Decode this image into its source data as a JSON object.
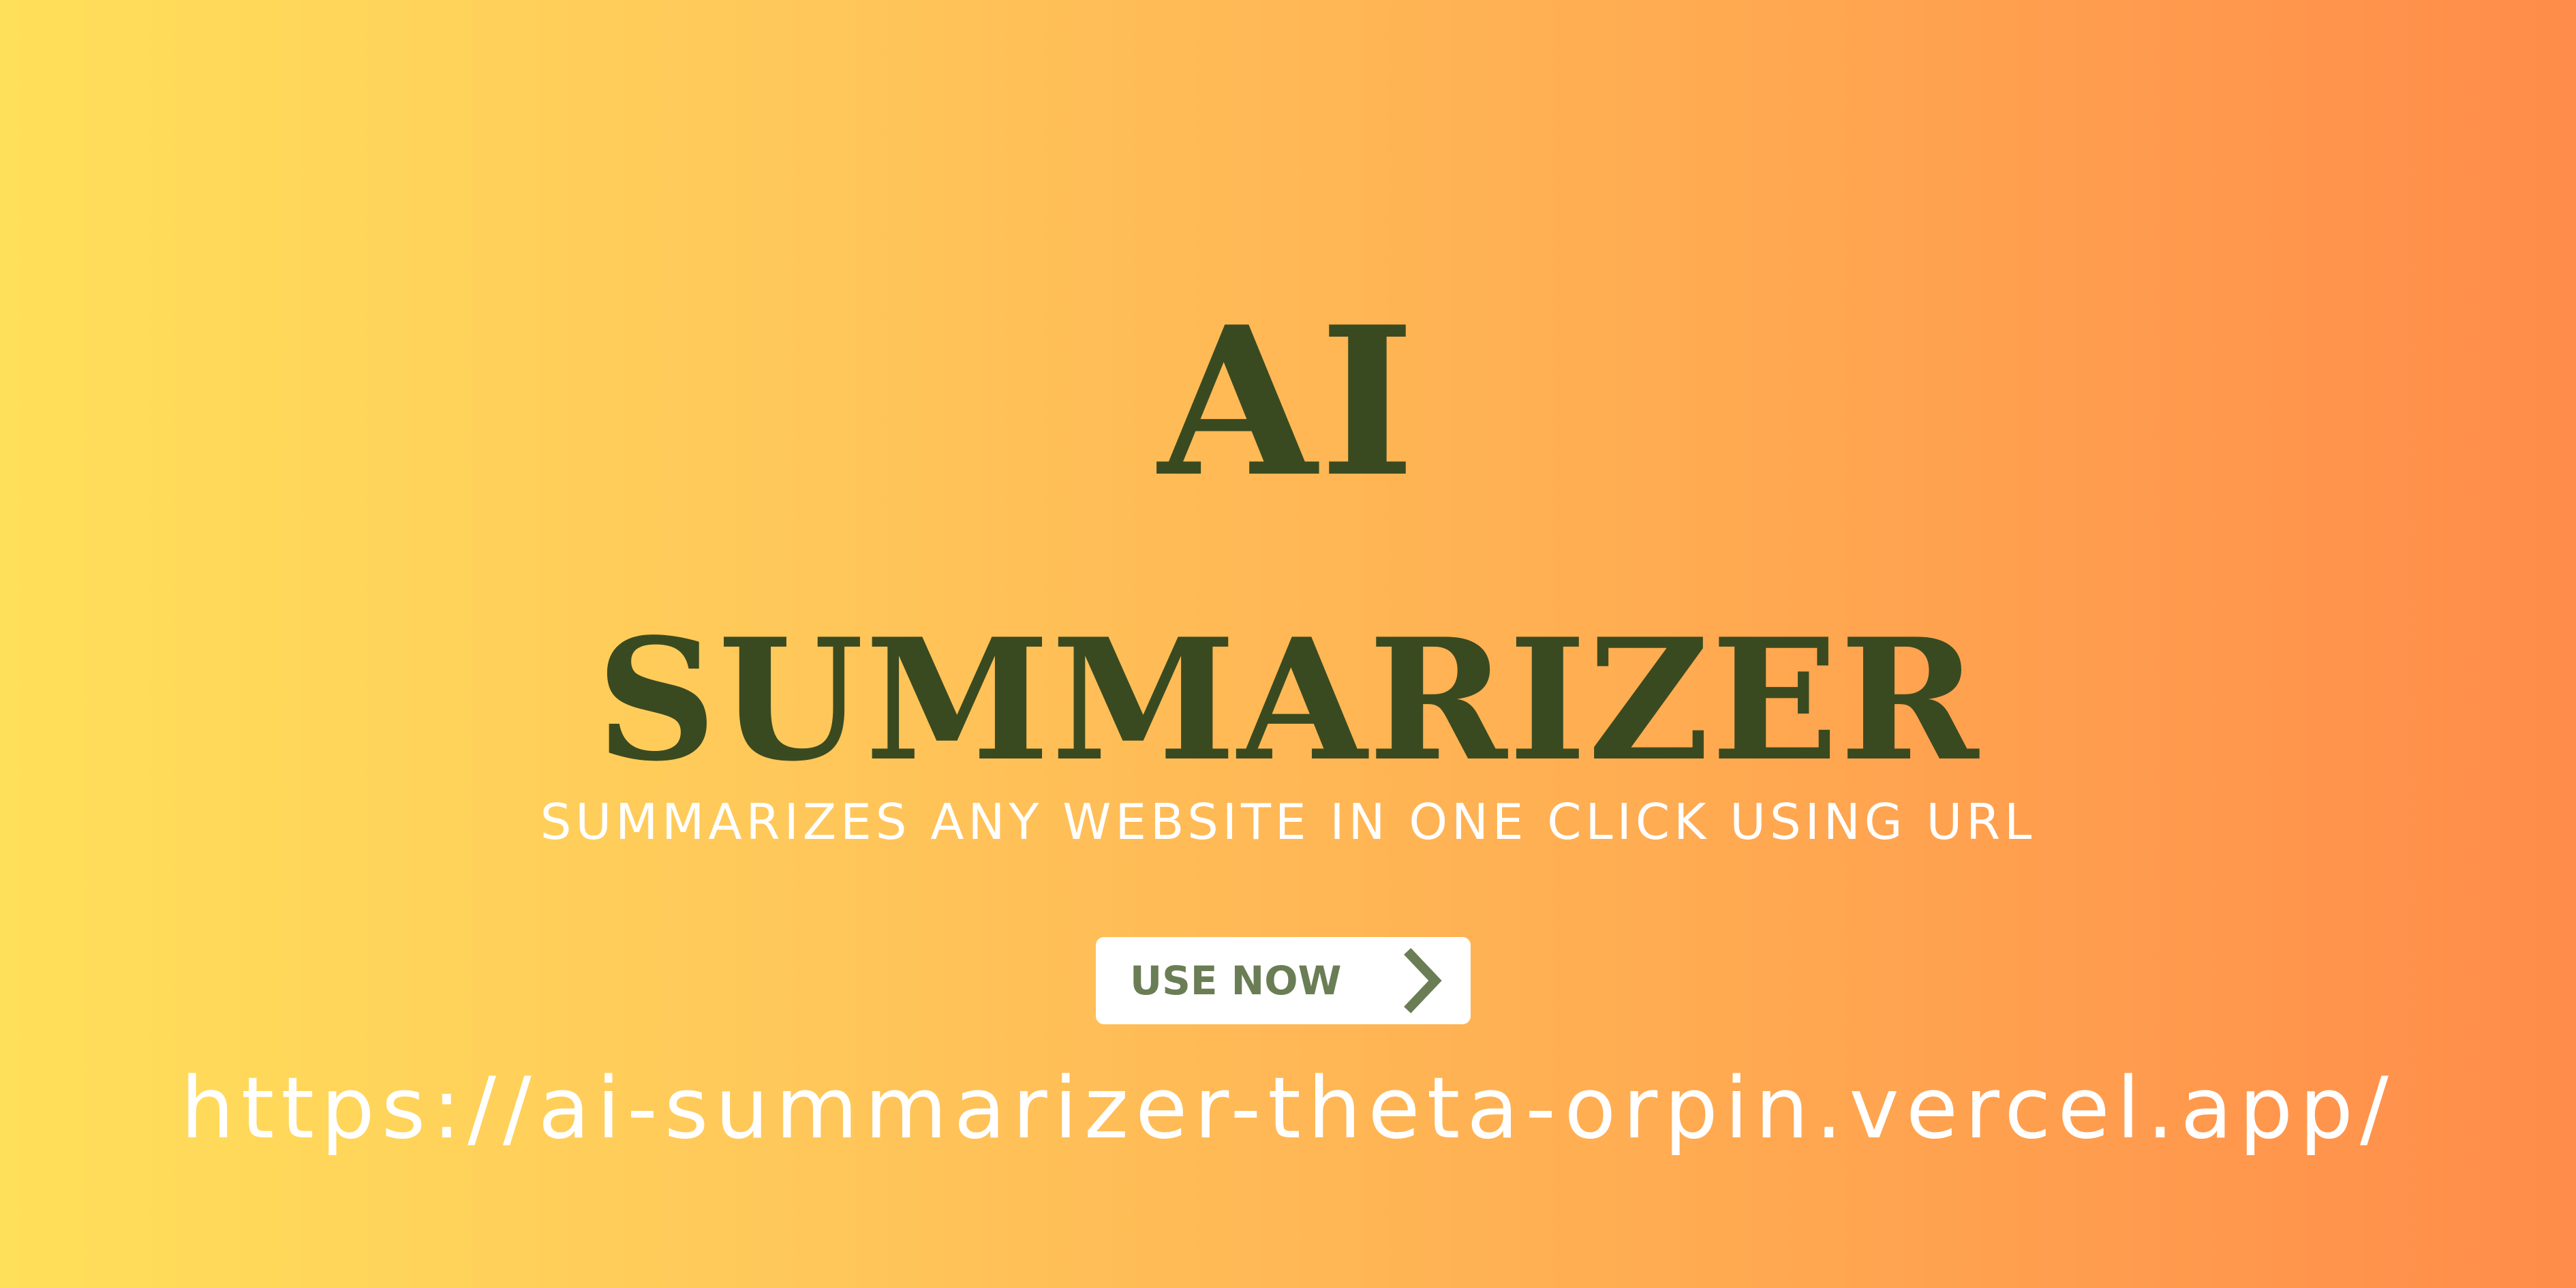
{
  "hero": {
    "title_line_1": "AI",
    "title_line_2": "SUMMARIZER",
    "tagline": "SUMMARIZES ANY WEBSITE IN ONE CLICK USING URL",
    "cta": {
      "label": "USE NOW",
      "icon": "chevron-right-icon"
    },
    "url": "https://ai-summarizer-theta-orpin.vercel.app/"
  },
  "colors": {
    "gradient_start": "#FFE05A",
    "gradient_end": "#FF8C4A",
    "title": "#3A4A20",
    "button_background": "#FFFFFF",
    "button_text": "#6A7D55",
    "light_text": "#FFFFFF"
  }
}
